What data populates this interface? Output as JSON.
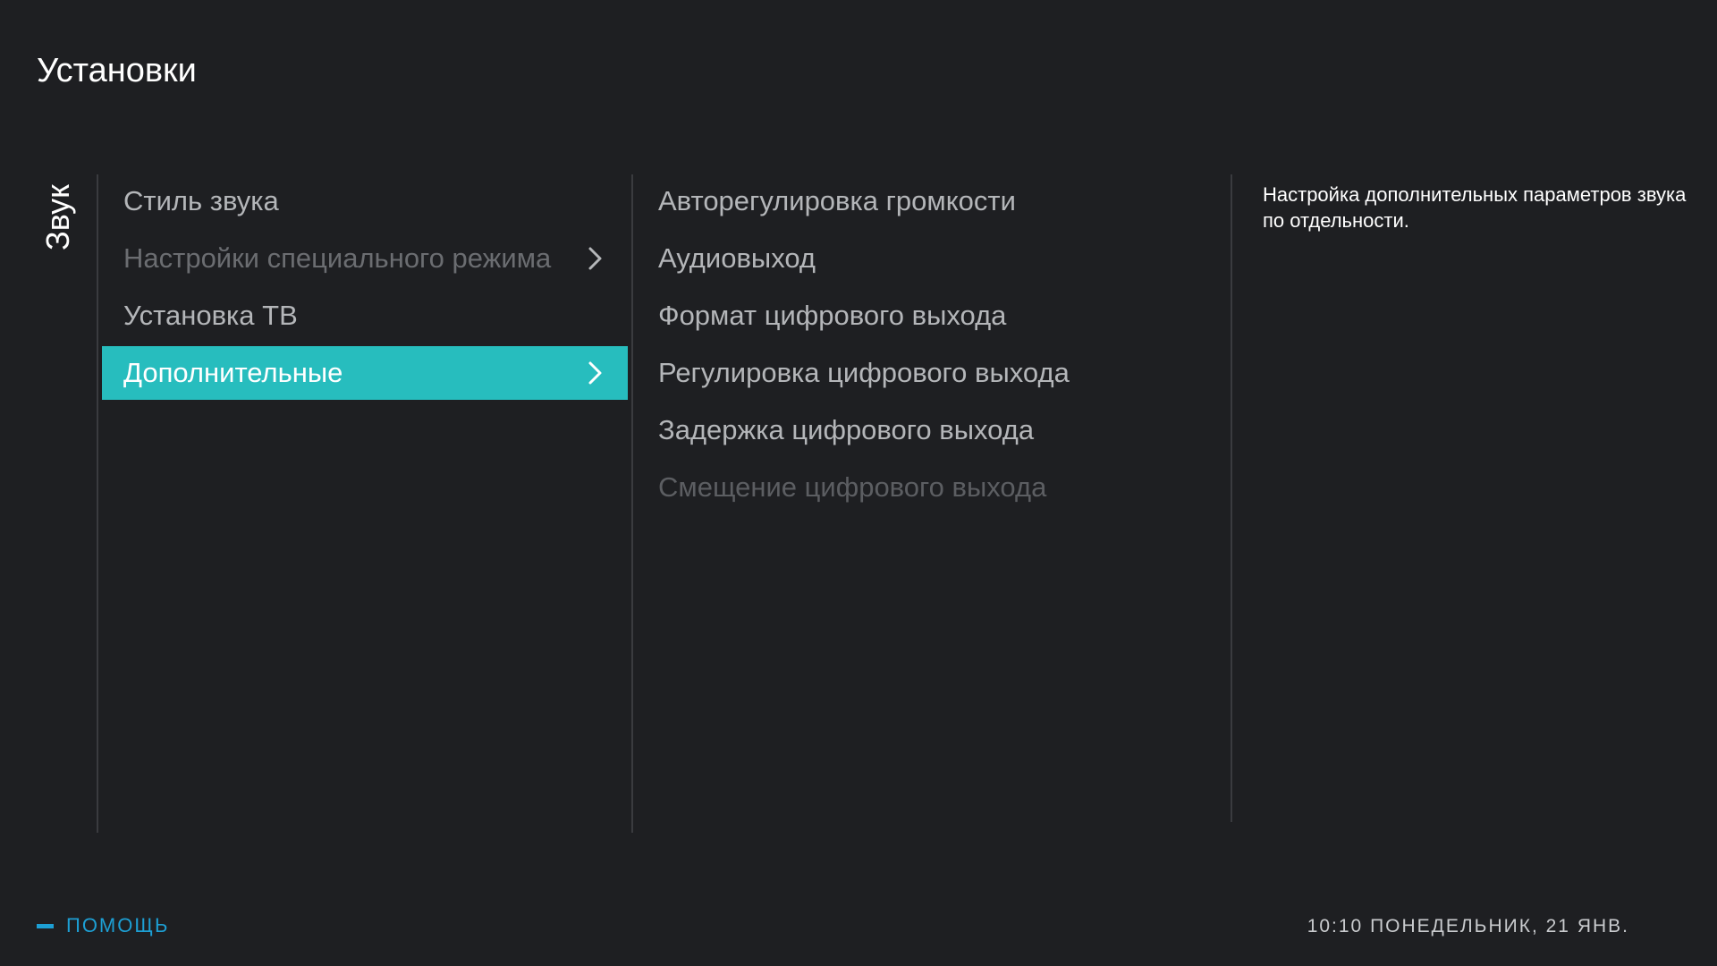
{
  "header": {
    "title": "Установки"
  },
  "section": {
    "label": "Звук"
  },
  "menu": {
    "items": [
      {
        "label": "Стиль звука",
        "state": "normal",
        "has_submenu": false
      },
      {
        "label": "Настройки специального режима",
        "state": "disabled",
        "has_submenu": true
      },
      {
        "label": "Установка ТВ",
        "state": "normal",
        "has_submenu": false
      },
      {
        "label": "Дополнительные",
        "state": "selected",
        "has_submenu": true
      }
    ]
  },
  "submenu": {
    "items": [
      {
        "label": "Авторегулировка громкости",
        "state": "normal"
      },
      {
        "label": "Аудиовыход",
        "state": "normal"
      },
      {
        "label": "Формат цифрового выхода",
        "state": "normal"
      },
      {
        "label": "Регулировка цифрового выхода",
        "state": "normal"
      },
      {
        "label": "Задержка цифрового выхода",
        "state": "normal"
      },
      {
        "label": "Смещение цифрового выхода",
        "state": "disabled"
      }
    ]
  },
  "description": {
    "text": "Настройка дополнительных параметров звука по отдельности."
  },
  "footer": {
    "help_label": "ПОМОЩЬ",
    "help_icon": "minus-key-icon",
    "clock": "10:10 ПОНЕДЕЛЬНИК, 21 ЯНВ."
  },
  "colors": {
    "background": "#1e1f22",
    "accent_selected": "#27bdbe",
    "help_blue": "#1d9fd4",
    "text_normal": "#b4b6b9",
    "text_disabled": "#6b6d71"
  }
}
